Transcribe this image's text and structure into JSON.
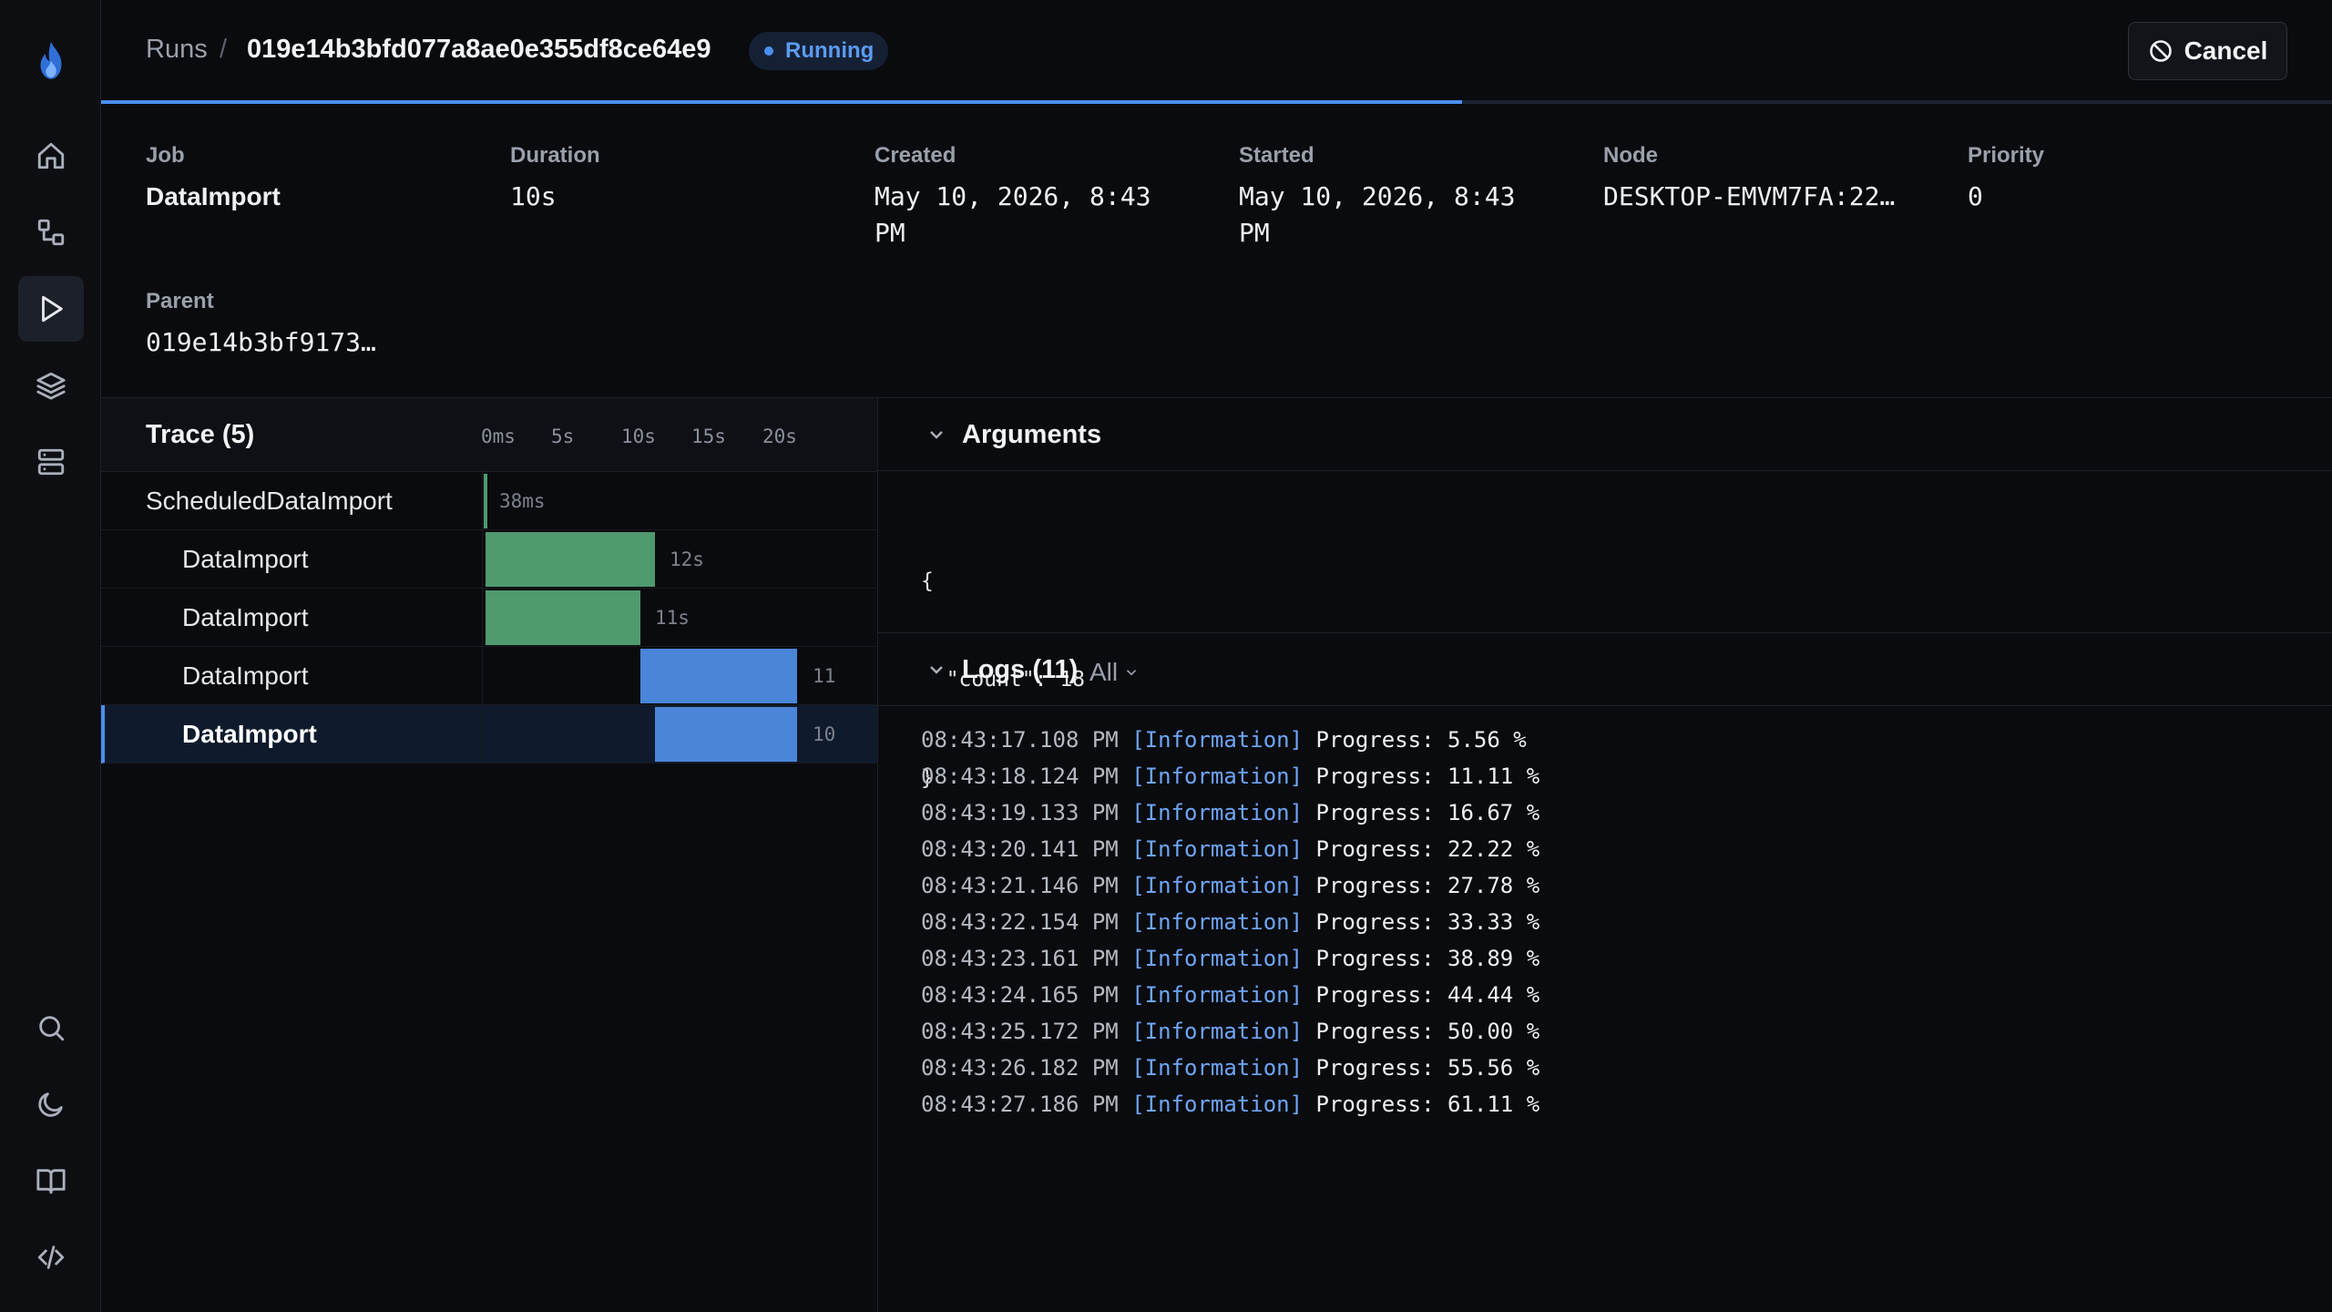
{
  "sidebar": {
    "items": [
      {
        "name": "home",
        "icon": "home-icon"
      },
      {
        "name": "jobs",
        "icon": "workflow-icon"
      },
      {
        "name": "runs",
        "icon": "play-icon",
        "active": true
      },
      {
        "name": "queues",
        "icon": "layers-icon"
      },
      {
        "name": "servers",
        "icon": "server-icon"
      }
    ],
    "bottom": [
      "search-icon",
      "moon-icon",
      "book-icon",
      "code-icon"
    ]
  },
  "header": {
    "breadcrumb_root": "Runs",
    "separator": "/",
    "run_id": "019e14b3bfd077a8ae0e355df8ce64e9",
    "status": "Running",
    "cancel_label": "Cancel"
  },
  "progress": 0.61,
  "meta": {
    "job": {
      "label": "Job",
      "value": "DataImport"
    },
    "duration": {
      "label": "Duration",
      "value": "10s"
    },
    "created": {
      "label": "Created",
      "value": "May 10, 2026, 8:43 PM"
    },
    "started": {
      "label": "Started",
      "value": "May 10, 2026, 8:43 PM"
    },
    "node": {
      "label": "Node",
      "value": "DESKTOP-EMVM7FA:22…"
    },
    "priority": {
      "label": "Priority",
      "value": "0"
    },
    "parent": {
      "label": "Parent",
      "value": "019e14b3bf9173…"
    }
  },
  "trace": {
    "title": "Trace (5)",
    "ticks": [
      "0ms",
      "5s",
      "10s",
      "15s",
      "20s"
    ],
    "rows": [
      {
        "name": "ScheduledDataImport",
        "duration": "38ms"
      },
      {
        "name": "DataImport",
        "duration": "12s"
      },
      {
        "name": "DataImport",
        "duration": "11s"
      },
      {
        "name": "DataImport",
        "duration": "11"
      },
      {
        "name": "DataImport",
        "duration": "10"
      }
    ]
  },
  "arguments": {
    "title": "Arguments",
    "json_lines": [
      "{",
      "  \"count\": 18",
      "}"
    ]
  },
  "logs": {
    "title": "Logs (11)",
    "filter": "All",
    "entries": [
      {
        "time": "08:43:17.108 PM",
        "level": "[Information]",
        "msg": "Progress: 5.56 %"
      },
      {
        "time": "08:43:18.124 PM",
        "level": "[Information]",
        "msg": "Progress: 11.11 %"
      },
      {
        "time": "08:43:19.133 PM",
        "level": "[Information]",
        "msg": "Progress: 16.67 %"
      },
      {
        "time": "08:43:20.141 PM",
        "level": "[Information]",
        "msg": "Progress: 22.22 %"
      },
      {
        "time": "08:43:21.146 PM",
        "level": "[Information]",
        "msg": "Progress: 27.78 %"
      },
      {
        "time": "08:43:22.154 PM",
        "level": "[Information]",
        "msg": "Progress: 33.33 %"
      },
      {
        "time": "08:43:23.161 PM",
        "level": "[Information]",
        "msg": "Progress: 38.89 %"
      },
      {
        "time": "08:43:24.165 PM",
        "level": "[Information]",
        "msg": "Progress: 44.44 %"
      },
      {
        "time": "08:43:25.172 PM",
        "level": "[Information]",
        "msg": "Progress: 50.00 %"
      },
      {
        "time": "08:43:26.182 PM",
        "level": "[Information]",
        "msg": "Progress: 55.56 %"
      },
      {
        "time": "08:43:27.186 PM",
        "level": "[Information]",
        "msg": "Progress: 61.11 %"
      }
    ]
  },
  "colors": {
    "accent": "#4a8ff0",
    "success_bar": "#4f9a6e",
    "running_bar": "#4a85d8"
  }
}
